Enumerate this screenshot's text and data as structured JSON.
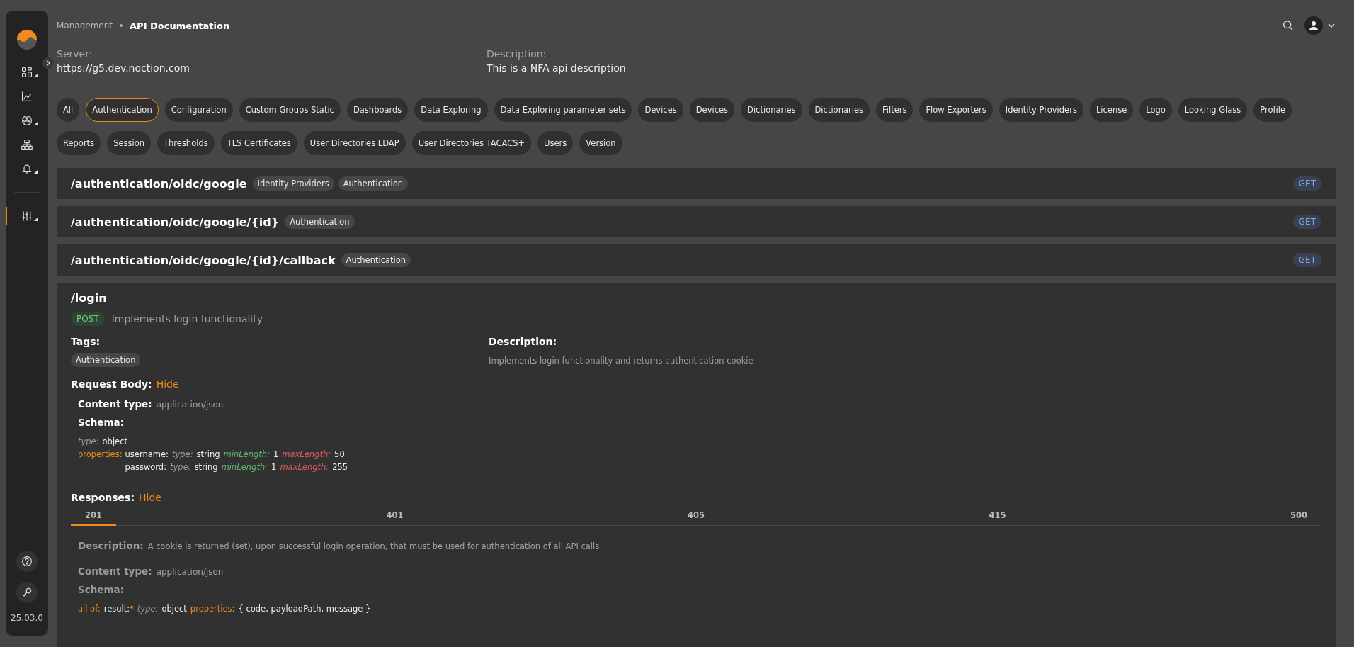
{
  "sidebar": {
    "version": "25.03.0",
    "groups": [
      {
        "items": [
          {
            "kind": "grid",
            "expandable": true,
            "selected": false
          },
          {
            "kind": "chart",
            "expandable": false,
            "selected": false
          },
          {
            "kind": "hub",
            "expandable": true,
            "selected": false
          },
          {
            "kind": "sitemap",
            "expandable": false,
            "selected": false
          },
          {
            "kind": "bell",
            "expandable": true,
            "selected": false
          }
        ]
      },
      {
        "items": [
          {
            "kind": "sliders",
            "expandable": true,
            "selected": true
          }
        ]
      }
    ]
  },
  "breadcrumb": {
    "parent": "Management",
    "current": "API Documentation"
  },
  "server": {
    "label": "Server:",
    "value": "https://g5.dev.noction.com"
  },
  "description": {
    "label": "Description:",
    "value": "This is a NFA api description"
  },
  "filters": [
    {
      "label": "All",
      "selected": false
    },
    {
      "label": "Authentication",
      "selected": true
    },
    {
      "label": "Configuration",
      "selected": false
    },
    {
      "label": "Custom Groups Static",
      "selected": false
    },
    {
      "label": "Dashboards",
      "selected": false
    },
    {
      "label": "Data Exploring",
      "selected": false
    },
    {
      "label": "Data Exploring parameter sets",
      "selected": false
    },
    {
      "label": "Devices",
      "selected": false
    },
    {
      "label": "Devices",
      "selected": false
    },
    {
      "label": "Dictionaries",
      "selected": false
    },
    {
      "label": "Dictionaries",
      "selected": false
    },
    {
      "label": "Filters",
      "selected": false
    },
    {
      "label": "Flow Exporters",
      "selected": false
    },
    {
      "label": "Identity Providers",
      "selected": false
    },
    {
      "label": "License",
      "selected": false
    },
    {
      "label": "Logo",
      "selected": false
    },
    {
      "label": "Looking Glass",
      "selected": false
    },
    {
      "label": "Profile",
      "selected": false
    },
    {
      "label": "Reports",
      "selected": false
    },
    {
      "label": "Session",
      "selected": false
    },
    {
      "label": "Thresholds",
      "selected": false
    },
    {
      "label": "TLS Certificates",
      "selected": false
    },
    {
      "label": "User Directories LDAP",
      "selected": false
    },
    {
      "label": "User Directories TACACS+",
      "selected": false
    },
    {
      "label": "Users",
      "selected": false
    },
    {
      "label": "Version",
      "selected": false
    }
  ],
  "endpoints": [
    {
      "path": "/authentication/oidc/google",
      "tags": [
        "Identity Providers",
        "Authentication"
      ],
      "method": "GET"
    },
    {
      "path": "/authentication/oidc/google/{id}",
      "tags": [
        "Authentication"
      ],
      "method": "GET"
    },
    {
      "path": "/authentication/oidc/google/{id}/callback",
      "tags": [
        "Authentication"
      ],
      "method": "GET"
    }
  ],
  "expanded_endpoint": {
    "path": "/login",
    "method": "POST",
    "summary": "Implements login functionality",
    "tags_label": "Tags:",
    "tags": [
      "Authentication"
    ],
    "description_label": "Description:",
    "description": "Implements login functionality and returns authentication cookie",
    "request_body": {
      "label": "Request Body:",
      "toggle": "Hide",
      "content_type_label": "Content type:",
      "content_type": "application/json",
      "schema_label": "Schema:",
      "type_label": "type:",
      "type": "object",
      "properties_label": "properties:",
      "properties": [
        {
          "name": "username:",
          "fields": [
            {
              "kind": "meta",
              "text": "type:"
            },
            {
              "kind": "value",
              "text": "string"
            },
            {
              "kind": "min",
              "text": "minLength:"
            },
            {
              "kind": "value",
              "text": "1"
            },
            {
              "kind": "max",
              "text": "maxLength:"
            },
            {
              "kind": "value",
              "text": "50"
            }
          ]
        },
        {
          "name": "password:",
          "fields": [
            {
              "kind": "meta",
              "text": "type:"
            },
            {
              "kind": "value",
              "text": "string"
            },
            {
              "kind": "min",
              "text": "minLength:"
            },
            {
              "kind": "value",
              "text": "1"
            },
            {
              "kind": "max",
              "text": "maxLength:"
            },
            {
              "kind": "value",
              "text": "255"
            }
          ]
        }
      ]
    },
    "responses": {
      "label": "Responses:",
      "toggle": "Hide",
      "tabs": [
        {
          "label": "201",
          "selected": true
        },
        {
          "label": "401",
          "selected": false
        },
        {
          "label": "405",
          "selected": false
        },
        {
          "label": "415",
          "selected": false
        },
        {
          "label": "500",
          "selected": false
        }
      ],
      "description_label": "Description:",
      "description": "A cookie is returned (set), upon successful login operation, that must be used for authentication of all API calls",
      "content_type_label": "Content type:",
      "content_type": "application/json",
      "schema_label": "Schema:",
      "schema_line": [
        {
          "kind": "key",
          "text": "all of:"
        },
        {
          "kind": "value",
          "text": "result:"
        },
        {
          "kind": "star",
          "text": "*"
        },
        {
          "kind": "meta",
          "text": "type:"
        },
        {
          "kind": "value",
          "text": "object"
        },
        {
          "kind": "key",
          "text": "properties:"
        },
        {
          "kind": "value",
          "text": "{ code, payloadPath, message }"
        }
      ]
    }
  }
}
